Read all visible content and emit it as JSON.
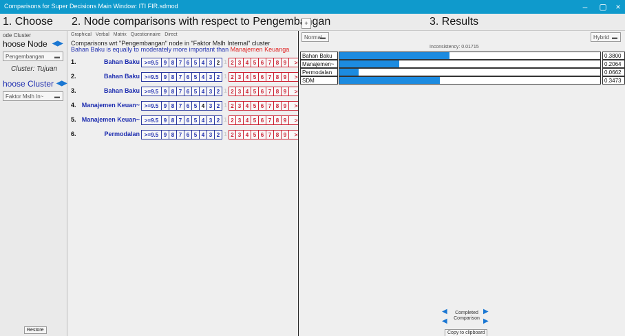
{
  "window": {
    "title": "Comparisons for Super Decisions Main Window: ITI FIR.sdmod",
    "minimize": "‒",
    "maximize": "▢",
    "close": "×"
  },
  "section1": {
    "header": "1. Choose"
  },
  "section2": {
    "header": "2. Node comparisons with respect to Pengembangan",
    "header_btn": "+"
  },
  "section3": {
    "header": "3. Results"
  },
  "left": {
    "node_cluster_label": "ode Cluster",
    "choose_node_label": "hoose Node",
    "node_select": "Pengembangan",
    "cluster_text": "Cluster: Tujuan",
    "choose_cluster_label": "hoose Cluster",
    "cluster_select": "Faktor Mslh In~",
    "restore_label": "Restore"
  },
  "comparison": {
    "tabs": [
      "Graphical",
      "Verbal",
      "Matrix",
      "Questionnaire",
      "Direct"
    ],
    "heading": "Comparisons wrt \"Pengembangan\" node in \"Faktor Mslh Internal\" cluster",
    "sentence_left": "Bahan Baku is equally to moderately more important than ",
    "sentence_right": "Manajemen Keuanga",
    "scale_left": [
      ">=9.5",
      "9",
      "8",
      "7",
      "6",
      "5",
      "4",
      "3",
      "2"
    ],
    "center": "1",
    "scale_right": [
      "2",
      "3",
      "4",
      "5",
      "6",
      "7",
      "8",
      "9",
      ">=9"
    ],
    "rows": [
      {
        "num": "1.",
        "name": "Bahan Baku",
        "sel_left": "2",
        "sel_right": ""
      },
      {
        "num": "2.",
        "name": "Bahan Baku",
        "sel_left": "",
        "sel_right": ""
      },
      {
        "num": "3.",
        "name": "Bahan Baku",
        "sel_left": "",
        "sel_right": ""
      },
      {
        "num": "4.",
        "name": "Manajemen Keuan~",
        "sel_left": "4",
        "sel_right": ""
      },
      {
        "num": "5.",
        "name": "Manajemen Keuan~",
        "sel_left": "",
        "sel_right": "2"
      },
      {
        "num": "6.",
        "name": "Permodalan",
        "sel_left": "",
        "sel_right": "4"
      }
    ]
  },
  "results": {
    "mode_left": "Normal",
    "mode_right": "Hybrid",
    "inconsistency": "Inconsistency: 0.01715",
    "items": [
      {
        "label": "Bahan Baku",
        "value": 0.38,
        "value_text": "0.3800"
      },
      {
        "label": "Manajemen~",
        "value": 0.2064,
        "value_text": "0.2064"
      },
      {
        "label": "Permodalan",
        "value": 0.0662,
        "value_text": "0.0662"
      },
      {
        "label": "SDM",
        "value": 0.3473,
        "value_text": "0.3473"
      }
    ],
    "completed_label": "Completed Comparison",
    "copy_label": "Copy to clipboard"
  },
  "colors": {
    "titlebar": "#0f9acc",
    "bar": "#1c8be0",
    "left_scale": "#1f2fb0",
    "right_scale": "#c23333"
  }
}
